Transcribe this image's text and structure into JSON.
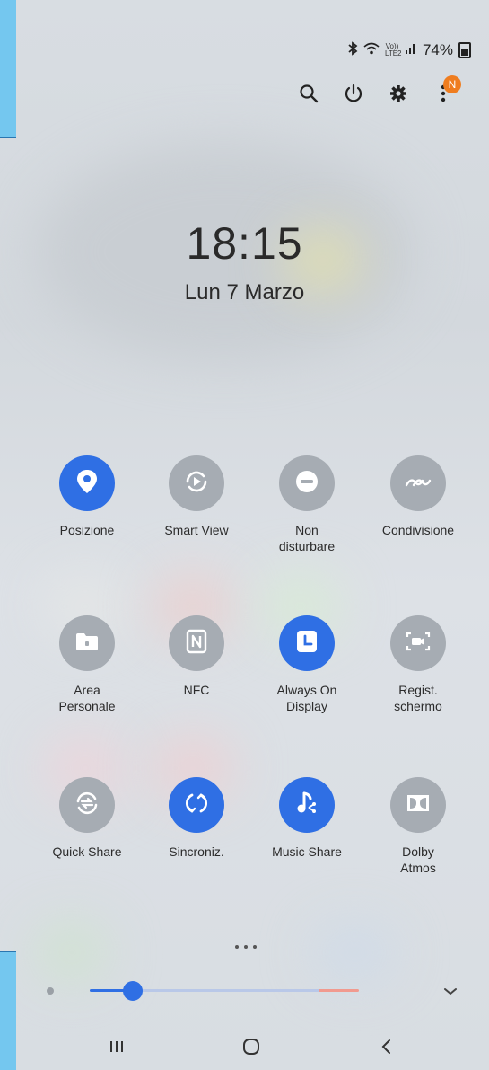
{
  "status_bar": {
    "volte_label": "Vo))\nLTE2",
    "battery_percent": "74%"
  },
  "icons": {
    "bluetooth": "bluetooth-icon",
    "wifi": "wifi-icon",
    "signal": "signal-icon",
    "search": "search-icon",
    "power": "power-icon",
    "settings": "gear-icon",
    "more": "more-vertical-icon",
    "brightness": "sun-icon",
    "expand": "chevron-down-icon"
  },
  "notification_badge": "N",
  "clock": {
    "time": "18:15",
    "date": "Lun 7 Marzo"
  },
  "tiles": [
    {
      "label": "Posizione",
      "icon": "location-pin-icon",
      "state": "on"
    },
    {
      "label": "Smart View",
      "icon": "smart-view-icon",
      "state": "off"
    },
    {
      "label": "Non disturbare",
      "icon": "do-not-disturb-icon",
      "state": "off"
    },
    {
      "label": "Condivisione",
      "icon": "hotspot-icon",
      "state": "off"
    },
    {
      "label": "Area Personale",
      "icon": "secure-folder-icon",
      "state": "off"
    },
    {
      "label": "NFC",
      "icon": "nfc-icon",
      "state": "off"
    },
    {
      "label": "Always On Display",
      "icon": "clock-icon",
      "state": "on"
    },
    {
      "label": "Regist. schermo",
      "icon": "screen-record-icon",
      "state": "off"
    },
    {
      "label": "Quick Share",
      "icon": "quick-share-icon",
      "state": "off"
    },
    {
      "label": "Sincroniz.",
      "icon": "sync-icon",
      "state": "on"
    },
    {
      "label": "Music Share",
      "icon": "music-share-icon",
      "state": "on"
    },
    {
      "label": "Dolby Atmos",
      "icon": "dolby-icon",
      "state": "off"
    }
  ],
  "brightness": {
    "level": 0.16
  },
  "colors": {
    "accent": "#2f6fe4",
    "tile_off": "#a6acb3",
    "badge": "#ef7d1f"
  },
  "nav": {
    "recents": "recents-icon",
    "home": "home-icon",
    "back": "back-icon"
  }
}
